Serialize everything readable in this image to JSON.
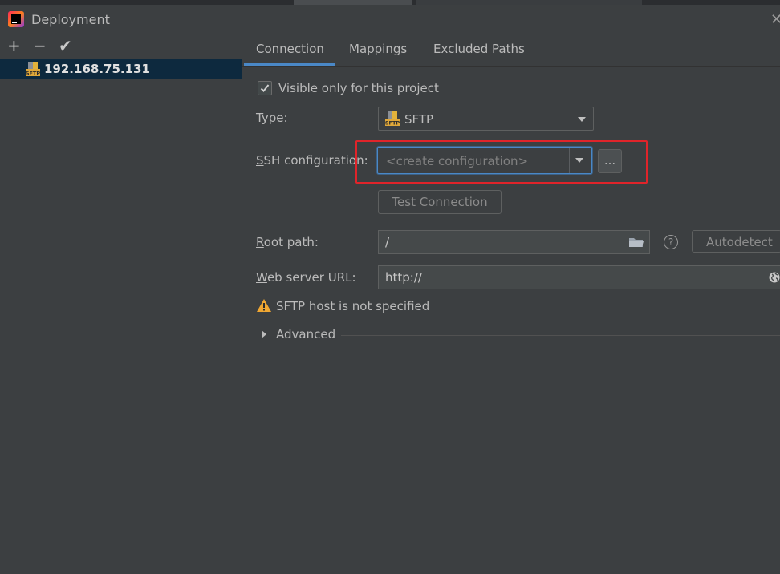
{
  "window": {
    "title": "Deployment"
  },
  "left_panel": {
    "toolbar": {
      "add": "+",
      "remove": "−",
      "apply": "✔"
    },
    "servers": [
      {
        "name": "192.168.75.131",
        "selected": true,
        "icon": "sftp-server-icon"
      }
    ]
  },
  "tabs": [
    {
      "label": "Connection",
      "active": true
    },
    {
      "label": "Mappings",
      "active": false
    },
    {
      "label": "Excluded Paths",
      "active": false
    }
  ],
  "connection": {
    "visible_only": {
      "label": "Visible only for this project",
      "checked": true
    },
    "type": {
      "label_u": "T",
      "label_rest": "ype:",
      "value": "SFTP"
    },
    "ssh": {
      "label_u": "S",
      "label_rest": "SH configuration:",
      "placeholder": "<create configuration>",
      "browse": "..."
    },
    "test_connection": "Test Connection",
    "root_path": {
      "label_u": "R",
      "label_rest": "oot path:",
      "value": "/",
      "help": "?",
      "autodetect": "Autodetect"
    },
    "web_url": {
      "label_u": "W",
      "label_rest": "eb server URL:",
      "value": "http://"
    },
    "warning": "SFTP host is not specified",
    "advanced": "Advanced"
  },
  "colors": {
    "highlight": "#e0242a",
    "accent": "#4a88c7",
    "selection": "#0d293e",
    "warning": "#f0a732"
  }
}
